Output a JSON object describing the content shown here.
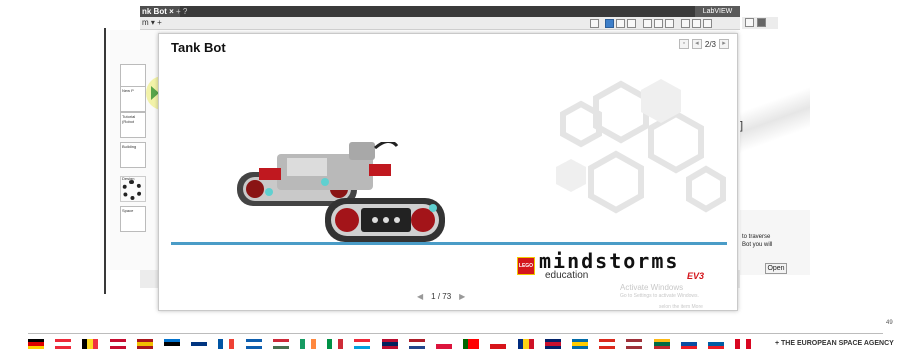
{
  "app": {
    "tab_label": "nk Bot",
    "tab_close": "×",
    "tab_add": "+",
    "tab_help": "?",
    "toolbar_label": "m ▾  +",
    "logo_button": "LabVIEW"
  },
  "sidebar": {
    "thumbnails": [
      {
        "label": ""
      },
      {
        "label": "New P"
      },
      {
        "label": "Tutorial (Robot"
      },
      {
        "label": "Building"
      },
      {
        "label": "Design"
      },
      {
        "label": "Space"
      }
    ]
  },
  "side_panel": {
    "text_line1": "to traverse",
    "text_line2": "Bot you will",
    "open_button": "Open",
    "bracket": "]"
  },
  "dialog": {
    "title": "Tank Bot",
    "page_indicator": "2/3",
    "pager_text": "1 / 73"
  },
  "brand": {
    "logo_text": "LEGO",
    "name": "mindstorms",
    "subtitle": "education",
    "badge": "EV3"
  },
  "watermark": {
    "title": "Activate Windows",
    "subtitle": "Go to Settings to activate Windows.",
    "extra": "selon the item More"
  },
  "slide": {
    "page_number": "49",
    "agency": "+ THE EUROPEAN SPACE AGENCY"
  },
  "flags": [
    {
      "name": "germany",
      "dir": "h",
      "colors": [
        "#000000",
        "#dd0000",
        "#ffce00"
      ]
    },
    {
      "name": "austria",
      "dir": "h",
      "colors": [
        "#ed2939",
        "#ffffff",
        "#ed2939"
      ]
    },
    {
      "name": "belgium",
      "dir": "v",
      "colors": [
        "#000000",
        "#fdda24",
        "#ef3340"
      ]
    },
    {
      "name": "denmark",
      "dir": "h",
      "colors": [
        "#c60c30",
        "#ffffff",
        "#c60c30"
      ]
    },
    {
      "name": "spain",
      "dir": "h",
      "colors": [
        "#aa151b",
        "#f1bf00",
        "#aa151b"
      ]
    },
    {
      "name": "estonia",
      "dir": "h",
      "colors": [
        "#0072ce",
        "#000000",
        "#ffffff"
      ]
    },
    {
      "name": "finland",
      "dir": "h",
      "colors": [
        "#ffffff",
        "#003580",
        "#ffffff"
      ]
    },
    {
      "name": "france",
      "dir": "v",
      "colors": [
        "#0055a4",
        "#ffffff",
        "#ef4135"
      ]
    },
    {
      "name": "greece",
      "dir": "h",
      "colors": [
        "#0d5eaf",
        "#ffffff",
        "#0d5eaf"
      ]
    },
    {
      "name": "hungary",
      "dir": "h",
      "colors": [
        "#ce2939",
        "#ffffff",
        "#477050"
      ]
    },
    {
      "name": "ireland",
      "dir": "v",
      "colors": [
        "#169b62",
        "#ffffff",
        "#ff883e"
      ]
    },
    {
      "name": "italy",
      "dir": "v",
      "colors": [
        "#009246",
        "#ffffff",
        "#ce2b37"
      ]
    },
    {
      "name": "luxembourg",
      "dir": "h",
      "colors": [
        "#ed2939",
        "#ffffff",
        "#00a1de"
      ]
    },
    {
      "name": "norway",
      "dir": "h",
      "colors": [
        "#ba0c2f",
        "#00205b",
        "#ba0c2f"
      ]
    },
    {
      "name": "netherlands",
      "dir": "h",
      "colors": [
        "#ae1c28",
        "#ffffff",
        "#21468b"
      ]
    },
    {
      "name": "poland",
      "dir": "h",
      "colors": [
        "#ffffff",
        "#dc143c"
      ]
    },
    {
      "name": "portugal",
      "dir": "v",
      "colors": [
        "#006600",
        "#ff0000",
        "#ff0000"
      ]
    },
    {
      "name": "czech-republic",
      "dir": "h",
      "colors": [
        "#ffffff",
        "#d7141a"
      ]
    },
    {
      "name": "romania",
      "dir": "v",
      "colors": [
        "#002b7f",
        "#fcd116",
        "#ce1126"
      ]
    },
    {
      "name": "united-kingdom",
      "dir": "h",
      "colors": [
        "#012169",
        "#c8102e",
        "#012169"
      ]
    },
    {
      "name": "sweden",
      "dir": "h",
      "colors": [
        "#006aa7",
        "#fecc00",
        "#006aa7"
      ]
    },
    {
      "name": "switzerland",
      "dir": "h",
      "colors": [
        "#da291c",
        "#ffffff",
        "#da291c"
      ]
    },
    {
      "name": "latvia",
      "dir": "h",
      "colors": [
        "#9e3039",
        "#ffffff",
        "#9e3039"
      ]
    },
    {
      "name": "lithuania",
      "dir": "h",
      "colors": [
        "#fdb913",
        "#006a44",
        "#c1272d"
      ]
    },
    {
      "name": "slovakia",
      "dir": "h",
      "colors": [
        "#ffffff",
        "#0b4ea2",
        "#ee1c25"
      ]
    },
    {
      "name": "slovenia",
      "dir": "h",
      "colors": [
        "#ffffff",
        "#005da4",
        "#ed1c24"
      ]
    },
    {
      "name": "canada",
      "dir": "v",
      "colors": [
        "#d80621",
        "#ffffff",
        "#d80621"
      ]
    }
  ]
}
